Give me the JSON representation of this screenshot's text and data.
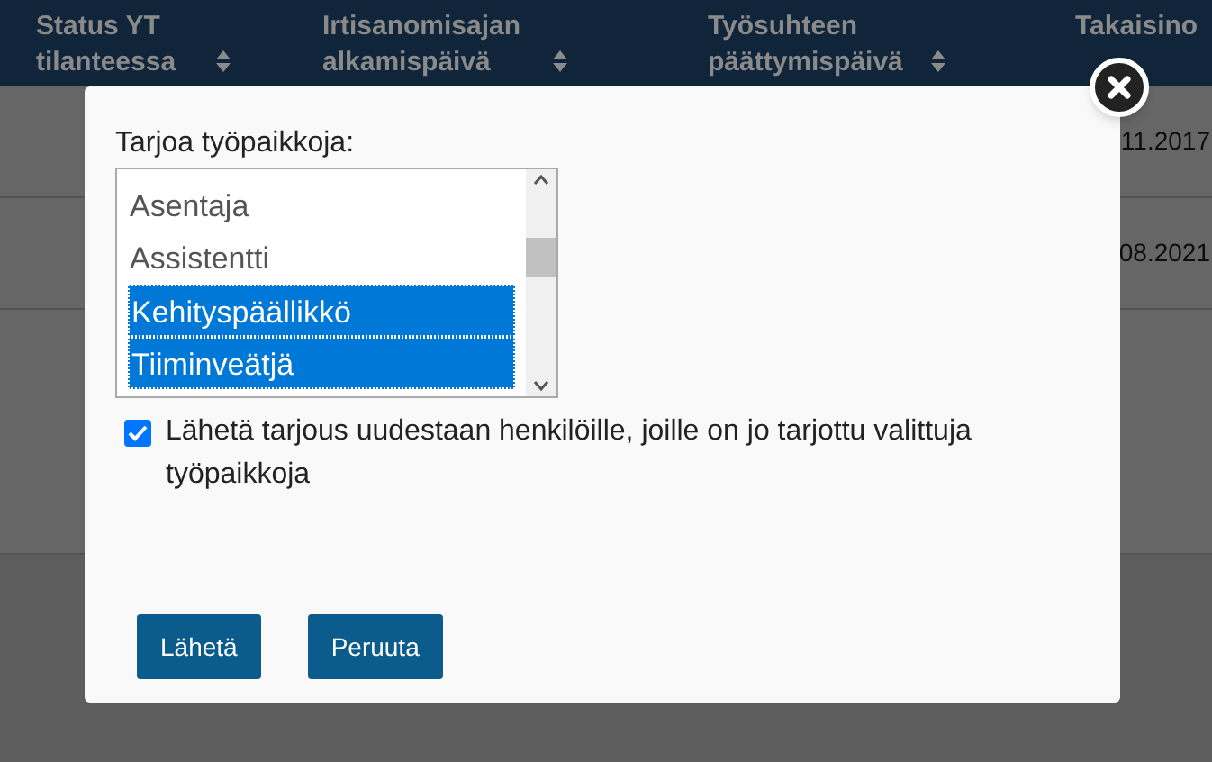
{
  "table": {
    "columns": [
      {
        "label": "Status YT tilanteessa",
        "sortable": true
      },
      {
        "label": "Irtisanomisajan alkamispäivä",
        "sortable": true
      },
      {
        "label": "Työsuhteen päättymispäivä",
        "sortable": true
      },
      {
        "label": "Takaisino",
        "sortable": false
      }
    ],
    "rows": [
      {
        "last_cell": "11.2017"
      },
      {
        "last_cell": "08.2021"
      }
    ]
  },
  "dialog": {
    "label": "Tarjoa työpaikkoja:",
    "options": [
      {
        "label": "Asentaja",
        "selected": false
      },
      {
        "label": "Assistentti",
        "selected": false
      },
      {
        "label": "Kehityspäällikkö",
        "selected": true
      },
      {
        "label": "Tiiminveätjä",
        "selected": true
      }
    ],
    "resend": {
      "label": "Lähetä tarjous uudestaan henkilöille, joille on jo tarjottu valittuja työpaikkoja",
      "checked": true
    },
    "buttons": [
      "Lähetä",
      "Peruuta"
    ]
  }
}
